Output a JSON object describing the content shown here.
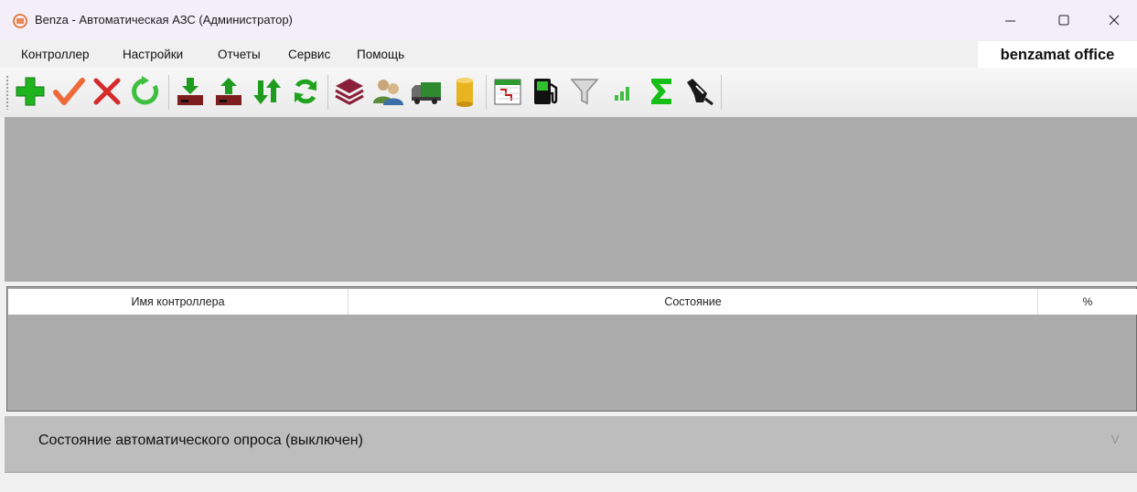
{
  "window": {
    "title": "Benza - Автоматическая АЗС (Администратор)",
    "controls": {
      "minimize": "minimize",
      "maximize": "maximize",
      "close": "close"
    }
  },
  "menu": {
    "items": [
      "Контроллер",
      "Настройки",
      "Отчеты",
      "Сервис",
      "Помощь"
    ],
    "brand": "benzamat office"
  },
  "toolbar": {
    "buttons": [
      {
        "icon": "add-icon"
      },
      {
        "icon": "check-icon"
      },
      {
        "icon": "delete-icon"
      },
      {
        "icon": "refresh-icon"
      },
      {
        "icon": "download-icon"
      },
      {
        "icon": "upload-icon"
      },
      {
        "icon": "exchange-icon"
      },
      {
        "icon": "sync-icon"
      },
      {
        "icon": "layers-icon"
      },
      {
        "icon": "users-icon"
      },
      {
        "icon": "truck-icon"
      },
      {
        "icon": "tank-icon"
      },
      {
        "icon": "calendar-icon"
      },
      {
        "icon": "fuel-pump-icon"
      },
      {
        "icon": "filter-icon"
      },
      {
        "icon": "signal-icon"
      },
      {
        "icon": "sum-icon"
      },
      {
        "icon": "nozzle-icon"
      }
    ]
  },
  "grid": {
    "columns": [
      "Имя контроллера",
      "Состояние",
      "%"
    ]
  },
  "status": {
    "text": "Состояние автоматического опроса (выключен)"
  },
  "colors": {
    "panel": "#ababab",
    "status_panel": "#bdbdbd",
    "titlebar": "#f3eef8",
    "green": "#1ea21e",
    "red": "#d42b2b",
    "dark_red": "#7d1d1d"
  }
}
